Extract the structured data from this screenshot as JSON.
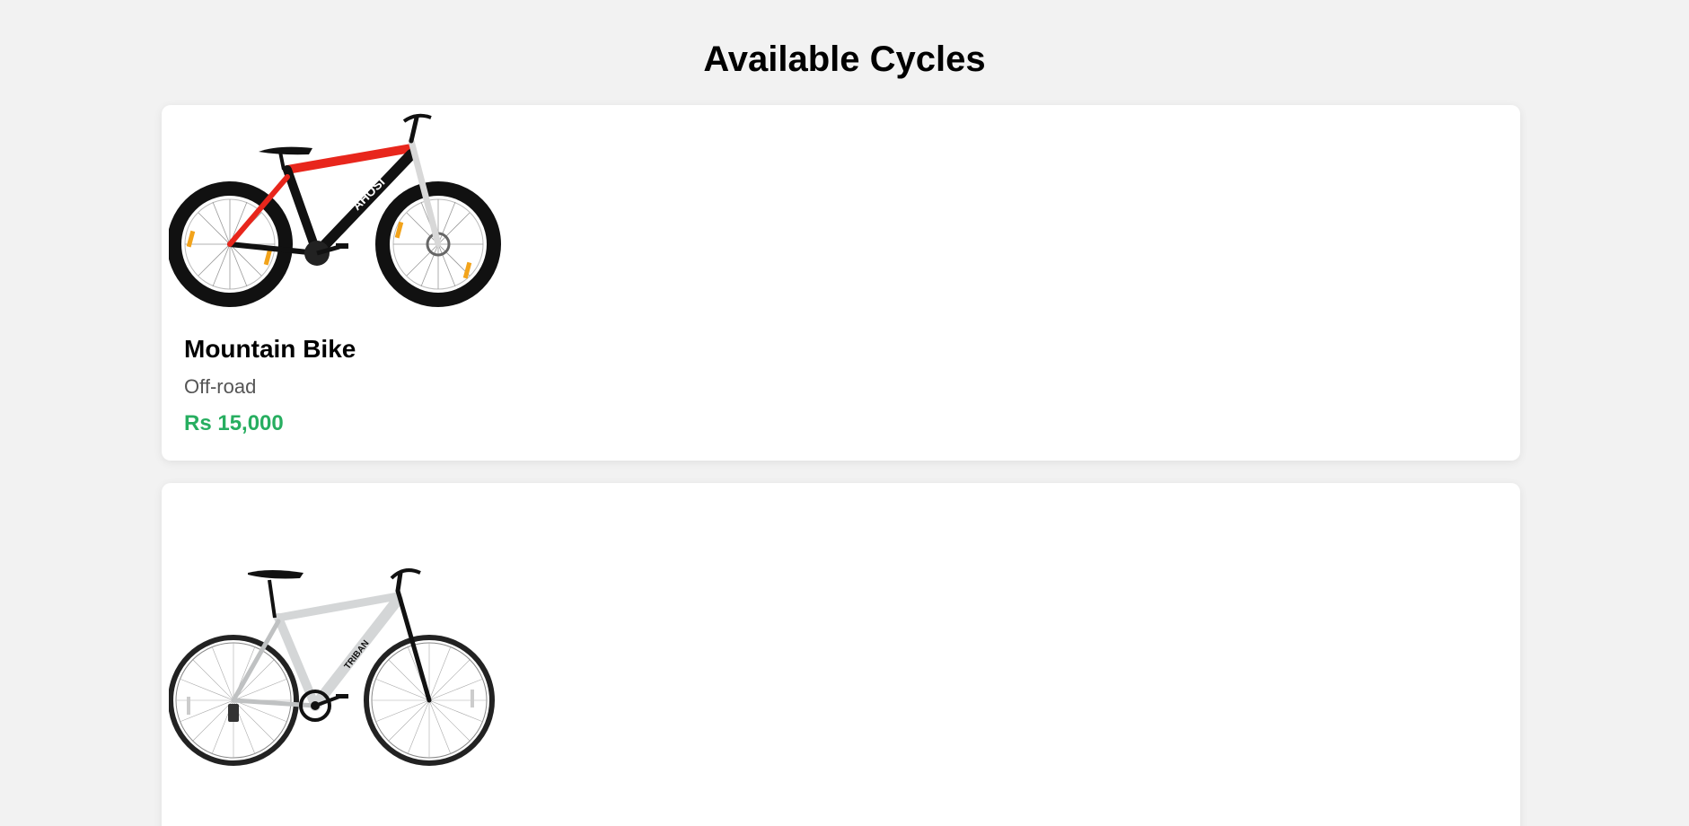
{
  "page": {
    "title": "Available Cycles"
  },
  "cycles": [
    {
      "name": "Mountain Bike",
      "type": "Off-road",
      "price": "Rs 15,000",
      "image_icon": "mountain-bike-image",
      "frame_color": "#e8261c",
      "brand_mark": "AHOSI"
    },
    {
      "image_icon": "road-bike-image",
      "frame_color": "#d4d6d7",
      "brand_mark": "TRIBAN"
    }
  ],
  "colors": {
    "background": "#f2f2f2",
    "card": "#ffffff",
    "price": "#27ae60",
    "subtext": "#555555"
  }
}
